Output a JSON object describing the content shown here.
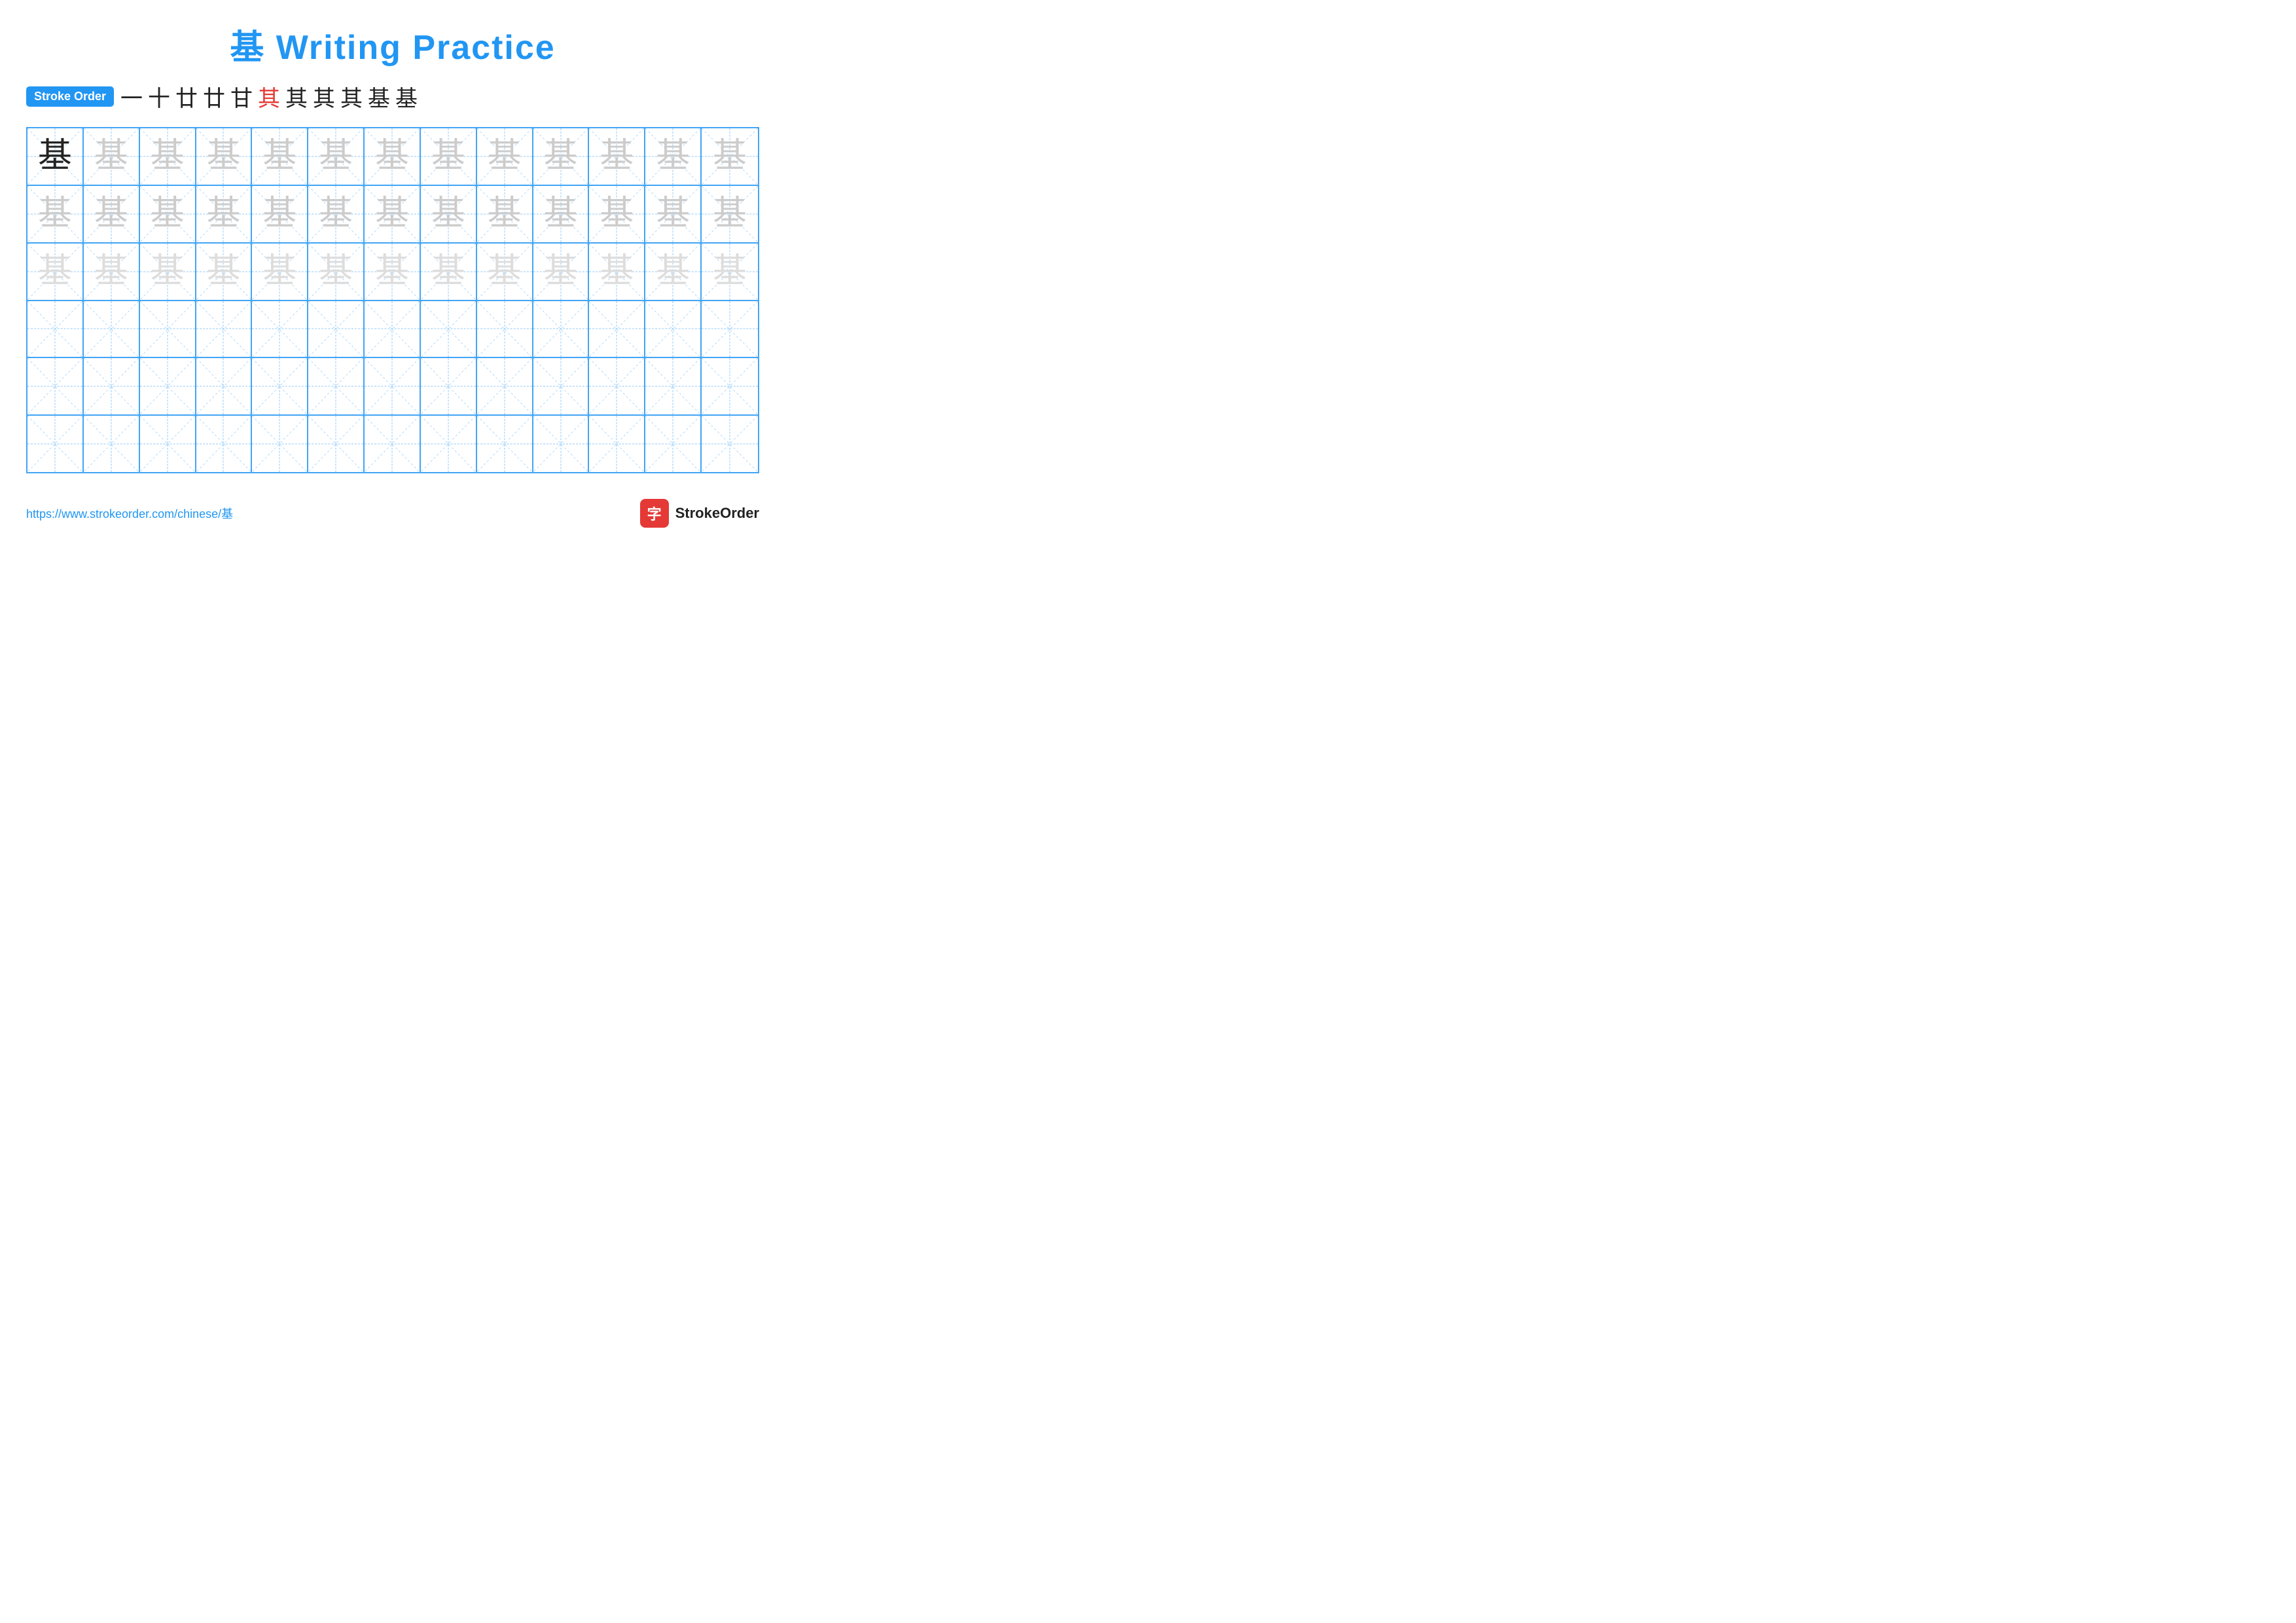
{
  "title": {
    "char": "基",
    "text": "Writing Practice",
    "full": "基 Writing Practice"
  },
  "stroke_order": {
    "badge_label": "Stroke Order",
    "strokes": [
      {
        "char": "一",
        "red": false
      },
      {
        "char": "十",
        "red": false
      },
      {
        "char": "廿",
        "red": false
      },
      {
        "char": "廿",
        "red": false
      },
      {
        "char": "甘",
        "red": false
      },
      {
        "char": "其",
        "red": true
      },
      {
        "char": "其",
        "red": false
      },
      {
        "char": "其",
        "red": false
      },
      {
        "char": "其",
        "red": false
      },
      {
        "char": "基",
        "red": false
      },
      {
        "char": "基",
        "red": false
      }
    ]
  },
  "grid": {
    "rows": 6,
    "cols": 13,
    "main_char": "基",
    "row_configs": [
      {
        "type": "filled",
        "first_dark": true,
        "fade_level": "medium"
      },
      {
        "type": "filled",
        "first_dark": false,
        "fade_level": "medium"
      },
      {
        "type": "filled",
        "first_dark": false,
        "fade_level": "light"
      },
      {
        "type": "empty"
      },
      {
        "type": "empty"
      },
      {
        "type": "empty"
      }
    ]
  },
  "footer": {
    "url": "https://www.strokeorder.com/chinese/基",
    "logo_char": "字",
    "logo_name": "StrokeOrder"
  }
}
